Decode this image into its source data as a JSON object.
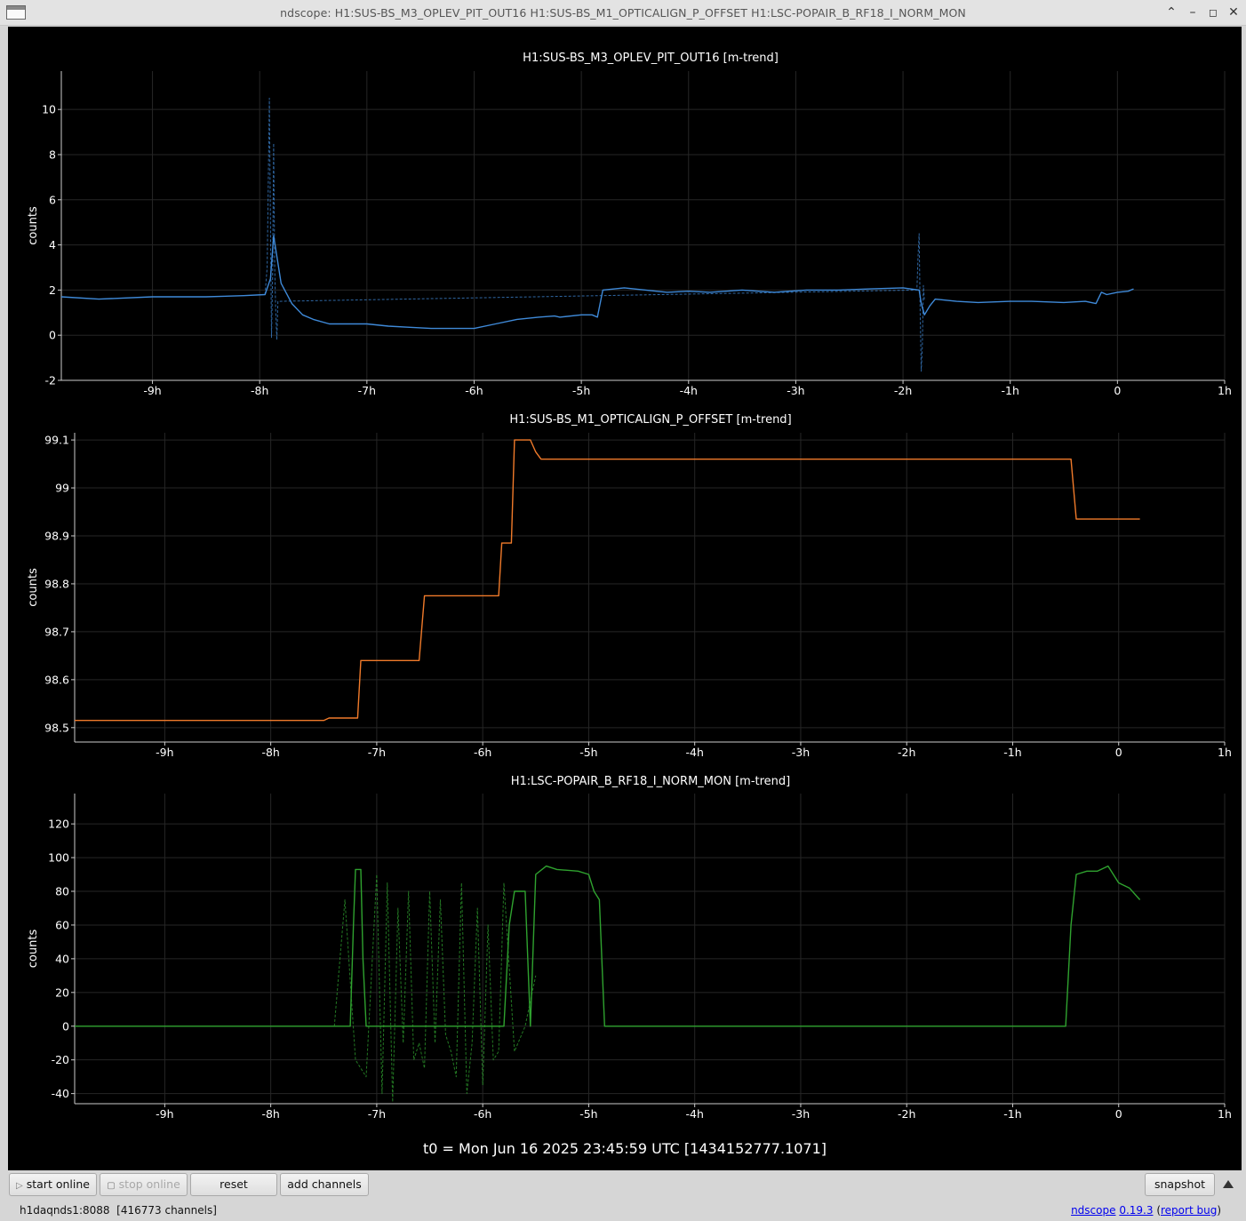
{
  "window": {
    "title": "ndscope: H1:SUS-BS_M3_OPLEV_PIT_OUT16 H1:SUS-BS_M1_OPTICALIGN_P_OFFSET H1:LSC-POPAIR_B_RF18_I_NORM_MON"
  },
  "x_ticks": [
    "-9h",
    "-8h",
    "-7h",
    "-6h",
    "-5h",
    "-4h",
    "-3h",
    "-2h",
    "-1h",
    "0",
    "1h"
  ],
  "plots": [
    {
      "title": "H1:SUS-BS_M3_OPLEV_PIT_OUT16 [m-trend]",
      "ylabel": "counts",
      "color": "#3f8ad9",
      "y_ticks": [
        "-2",
        "0",
        "2",
        "4",
        "6",
        "8",
        "10"
      ]
    },
    {
      "title": "H1:SUS-BS_M1_OPTICALIGN_P_OFFSET [m-trend]",
      "ylabel": "counts",
      "color": "#f07a2a",
      "y_ticks": [
        "98.5",
        "98.6",
        "98.7",
        "98.8",
        "98.9",
        "99",
        "99.1"
      ]
    },
    {
      "title": "H1:LSC-POPAIR_B_RF18_I_NORM_MON [m-trend]",
      "ylabel": "counts",
      "color": "#2fa22f",
      "y_ticks": [
        "-40",
        "-20",
        "0",
        "20",
        "40",
        "60",
        "80",
        "100",
        "120"
      ]
    }
  ],
  "chart_data": [
    {
      "type": "line",
      "title": "H1:SUS-BS_M3_OPLEV_PIT_OUT16 [m-trend]",
      "ylabel": "counts",
      "xlim": [
        -9.85,
        1.0
      ],
      "ylim": [
        -2,
        11.7
      ],
      "series": [
        {
          "x": [
            -9.85,
            -9.5,
            -9.0,
            -8.5,
            -8.15,
            -7.95,
            -7.9,
            -7.87,
            -7.8,
            -7.7,
            -7.6,
            -7.5,
            -7.35,
            -7.2,
            -7.0,
            -6.8,
            -6.6,
            -6.4,
            -6.2,
            -6.0,
            -5.8,
            -5.6,
            -5.4,
            -5.25,
            -5.2,
            -5.0,
            -4.9,
            -4.85,
            -4.8,
            -4.6,
            -4.4,
            -4.2,
            -4.0,
            -3.8,
            -3.5,
            -3.2,
            -2.9,
            -2.6,
            -2.3,
            -2.0,
            -1.85,
            -1.83,
            -1.8,
            -1.75,
            -1.7,
            -1.6,
            -1.5,
            -1.3,
            -1.0,
            -0.8,
            -0.5,
            -0.3,
            -0.2,
            -0.15,
            -0.1,
            0.0,
            0.1,
            0.15
          ],
          "y": [
            1.7,
            1.6,
            1.7,
            1.7,
            1.75,
            1.8,
            2.5,
            4.4,
            2.3,
            1.4,
            0.9,
            0.7,
            0.5,
            0.5,
            0.5,
            0.4,
            0.35,
            0.3,
            0.3,
            0.3,
            0.5,
            0.7,
            0.8,
            0.85,
            0.8,
            0.9,
            0.9,
            0.8,
            2.0,
            2.1,
            2.0,
            1.9,
            1.95,
            1.9,
            2.0,
            1.9,
            2.0,
            2.0,
            2.05,
            2.1,
            2.0,
            1.4,
            0.9,
            1.3,
            1.6,
            1.55,
            1.5,
            1.45,
            1.5,
            1.5,
            1.45,
            1.5,
            1.4,
            1.9,
            1.8,
            1.9,
            1.95,
            2.05
          ]
        },
        {
          "x": [
            -7.95,
            -7.93,
            -7.92,
            -7.91,
            -7.9,
            -7.89,
            -7.88,
            -7.87,
            -7.86,
            -7.85,
            -7.84,
            -7.83,
            -1.87,
            -1.86,
            -1.85,
            -1.84,
            -1.83,
            -1.82,
            -1.81,
            -1.8
          ],
          "y": [
            1.8,
            3.0,
            6.5,
            10.5,
            5.0,
            -0.1,
            2.5,
            8.5,
            3.0,
            1.0,
            -0.2,
            1.5,
            2.0,
            3.5,
            4.5,
            1.0,
            -1.6,
            -0.5,
            2.2,
            1.5
          ]
        }
      ]
    },
    {
      "type": "line",
      "title": "H1:SUS-BS_M1_OPTICALIGN_P_OFFSET [m-trend]",
      "ylabel": "counts",
      "xlim": [
        -9.85,
        1.0
      ],
      "ylim": [
        98.47,
        99.115
      ],
      "series": [
        {
          "x": [
            -9.85,
            -7.5,
            -7.45,
            -7.18,
            -7.15,
            -6.6,
            -6.55,
            -5.85,
            -5.82,
            -5.73,
            -5.7,
            -5.6,
            -5.55,
            -5.5,
            -5.45,
            -0.45,
            -0.4,
            0.2
          ],
          "y": [
            98.515,
            98.515,
            98.52,
            98.52,
            98.64,
            98.64,
            98.775,
            98.775,
            98.885,
            98.885,
            99.1,
            99.1,
            99.1,
            99.075,
            99.06,
            99.06,
            98.935,
            98.935
          ]
        }
      ]
    },
    {
      "type": "line",
      "title": "H1:LSC-POPAIR_B_RF18_I_NORM_MON [m-trend]",
      "ylabel": "counts",
      "xlim": [
        -9.85,
        1.0
      ],
      "ylim": [
        -46,
        138
      ],
      "series": [
        {
          "x": [
            -9.85,
            -7.25,
            -7.22,
            -7.2,
            -7.15,
            -7.13,
            -7.1,
            -5.8,
            -5.75,
            -5.7,
            -5.6,
            -5.55,
            -5.5,
            -5.4,
            -5.3,
            -5.1,
            -5.0,
            -4.95,
            -4.9,
            -4.85,
            -0.5,
            -0.45,
            -0.4,
            -0.3,
            -0.2,
            -0.1,
            0.0,
            0.1,
            0.2
          ],
          "y": [
            0,
            0,
            60,
            93,
            93,
            40,
            0,
            0,
            60,
            80,
            80,
            0,
            90,
            95,
            93,
            92,
            90,
            80,
            75,
            0,
            0,
            60,
            90,
            92,
            92,
            95,
            85,
            82,
            75
          ]
        },
        {
          "x": [
            -7.4,
            -7.3,
            -7.2,
            -7.1,
            -7.0,
            -6.95,
            -6.9,
            -6.85,
            -6.8,
            -6.75,
            -6.7,
            -6.65,
            -6.6,
            -6.55,
            -6.5,
            -6.45,
            -6.4,
            -6.35,
            -6.3,
            -6.25,
            -6.2,
            -6.15,
            -6.1,
            -6.05,
            -6.0,
            -5.95,
            -5.9,
            -5.85,
            -5.8,
            -5.7,
            -5.6,
            -5.5
          ],
          "y": [
            0,
            75,
            -20,
            -30,
            90,
            -40,
            85,
            -45,
            70,
            -10,
            80,
            -20,
            -10,
            -25,
            80,
            -10,
            75,
            -5,
            -15,
            -30,
            85,
            -40,
            -10,
            70,
            -35,
            60,
            -20,
            -15,
            85,
            -15,
            0,
            30
          ]
        }
      ]
    }
  ],
  "footer": {
    "t0": "t0 = Mon Jun 16 2025 23:45:59 UTC [1434152777.1071]"
  },
  "toolbar": {
    "start_online": "start online",
    "stop_online": "stop online",
    "reset": "reset",
    "add_channels": "add channels",
    "snapshot": "snapshot"
  },
  "status": {
    "server": "h1daqnds1:8088",
    "channels": "[416773 channels]",
    "app_name": "ndscope",
    "version": "0.19.3",
    "report_bug": "report bug"
  }
}
